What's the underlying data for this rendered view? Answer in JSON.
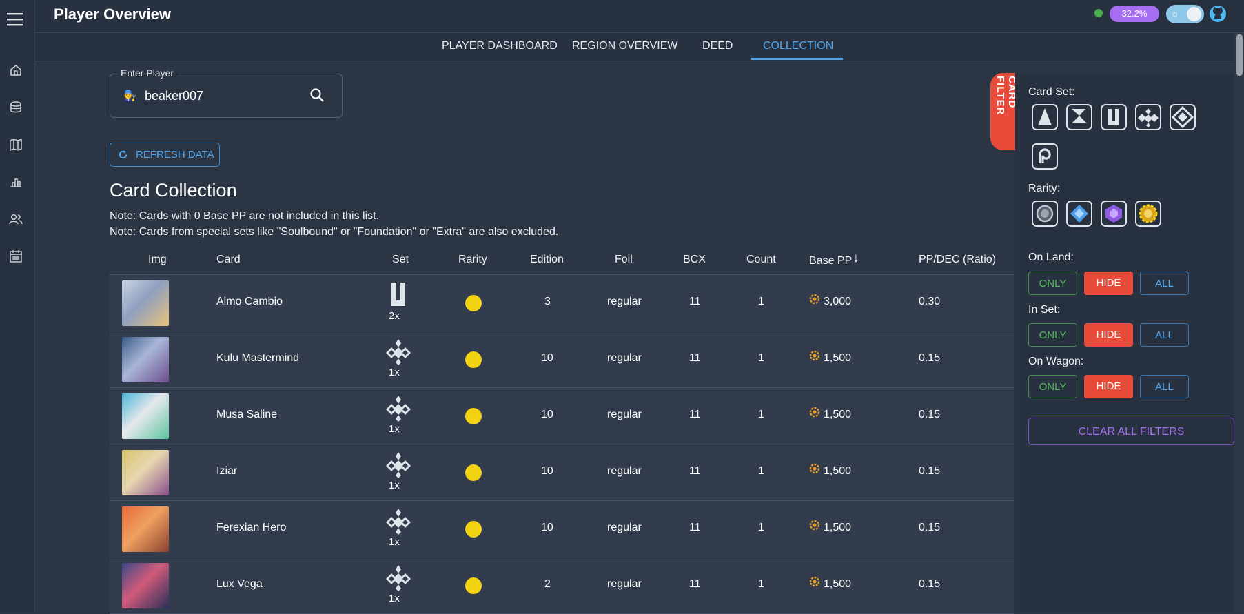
{
  "header": {
    "title": "Player Overview",
    "percent": "32.2%"
  },
  "tabs": [
    "PLAYER DASHBOARD",
    "REGION OVERVIEW",
    "DEED",
    "COLLECTION"
  ],
  "player_input": {
    "label": "Enter Player",
    "value": "beaker007",
    "emoji": "🧑‍🔧"
  },
  "refresh_label": "REFRESH DATA",
  "section_title": "Card Collection",
  "notes": [
    "Note: Cards with 0 Base PP are not included in this list.",
    "Note: Cards from special sets like \"Soulbound\" or \"Foundation\" or \"Extra\" are also excluded."
  ],
  "columns": [
    "Img",
    "Card",
    "Set",
    "Rarity",
    "Edition",
    "Foil",
    "BCX",
    "Count",
    "Base PP",
    "PP/DEC (Ratio)"
  ],
  "rows": [
    {
      "card": "Almo Cambio",
      "set_count": "2x",
      "set_icon": "untamed-set-icon",
      "edition": "3",
      "foil": "regular",
      "bcx": "11",
      "count": "1",
      "base_pp": "3,000",
      "ratio": "0.30"
    },
    {
      "card": "Kulu Mastermind",
      "set_count": "1x",
      "set_icon": "chaos-set-icon",
      "edition": "10",
      "foil": "regular",
      "bcx": "11",
      "count": "1",
      "base_pp": "1,500",
      "ratio": "0.15"
    },
    {
      "card": "Musa Saline",
      "set_count": "1x",
      "set_icon": "chaos-set-icon",
      "edition": "10",
      "foil": "regular",
      "bcx": "11",
      "count": "1",
      "base_pp": "1,500",
      "ratio": "0.15"
    },
    {
      "card": "Iziar",
      "set_count": "1x",
      "set_icon": "chaos-set-icon",
      "edition": "10",
      "foil": "regular",
      "bcx": "11",
      "count": "1",
      "base_pp": "1,500",
      "ratio": "0.15"
    },
    {
      "card": "Ferexian Hero",
      "set_count": "1x",
      "set_icon": "chaos-set-icon",
      "edition": "10",
      "foil": "regular",
      "bcx": "11",
      "count": "1",
      "base_pp": "1,500",
      "ratio": "0.15"
    },
    {
      "card": "Lux Vega",
      "set_count": "1x",
      "set_icon": "chaos-set-icon",
      "edition": "2",
      "foil": "regular",
      "bcx": "11",
      "count": "1",
      "base_pp": "1,500",
      "ratio": "0.15"
    }
  ],
  "filter": {
    "tab_label": "CARD FILTER",
    "card_set_label": "Card Set:",
    "rarity_label": "Rarity:",
    "on_land_label": "On Land:",
    "in_set_label": "In Set:",
    "on_wagon_label": "On Wagon:",
    "only": "ONLY",
    "hide": "HIDE",
    "all": "ALL",
    "clear_label": "CLEAR ALL FILTERS"
  },
  "colors": {
    "accent": "#4fa8f0",
    "danger": "#e84b3a",
    "success": "#52b85a",
    "purple": "#a56ef0",
    "rarity_legendary": "#f2d213"
  }
}
